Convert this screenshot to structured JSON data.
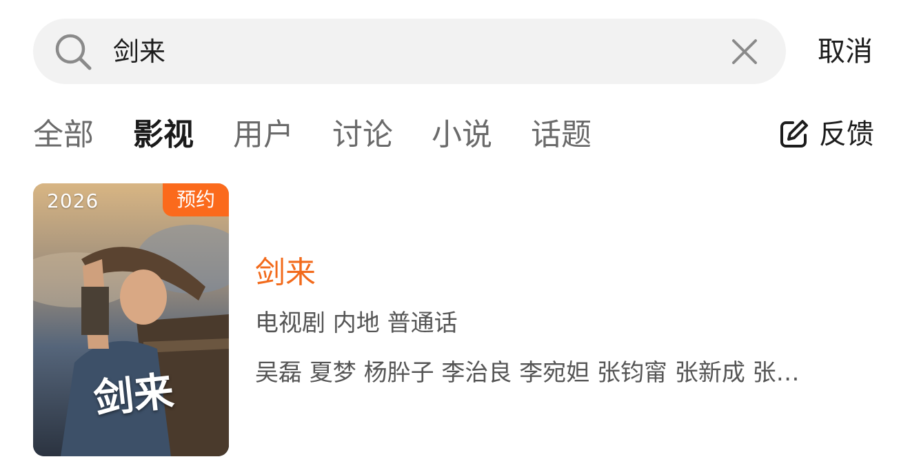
{
  "search": {
    "query": "剑来",
    "cancel_label": "取消"
  },
  "tabs": [
    {
      "label": "全部",
      "active": false
    },
    {
      "label": "影视",
      "active": true
    },
    {
      "label": "用户",
      "active": false
    },
    {
      "label": "讨论",
      "active": false
    },
    {
      "label": "小说",
      "active": false
    },
    {
      "label": "话题",
      "active": false
    }
  ],
  "feedback": {
    "label": "反馈"
  },
  "result": {
    "year": "2026",
    "badge": "预约",
    "poster_calligraphy": "剑来",
    "title": "剑来",
    "meta": "电视剧 内地 普通话",
    "cast": "吴磊 夏梦 杨肸子 李治良 李宛妲 张钧甯 张新成 张…"
  },
  "colors": {
    "accent": "#f26a1b",
    "badge_bg": "#fb6a1c",
    "search_bg": "#f2f2f2"
  },
  "icons": {
    "search": "search-icon",
    "clear": "close-icon",
    "feedback": "edit-icon"
  }
}
